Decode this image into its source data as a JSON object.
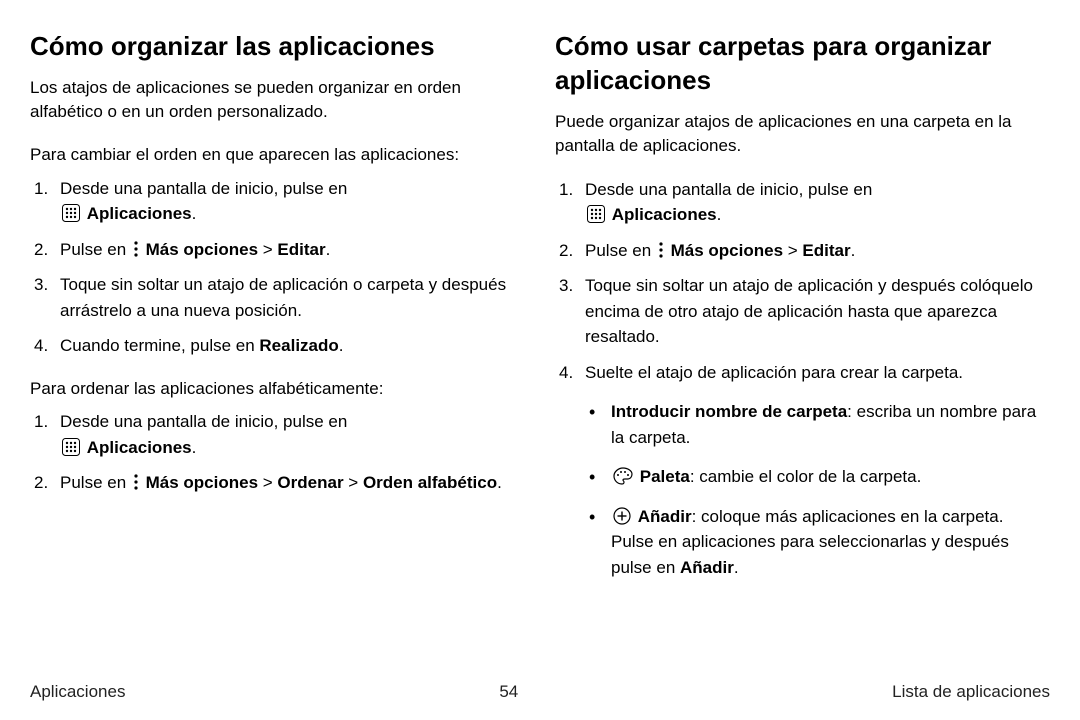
{
  "left": {
    "heading": "Cómo organizar las aplicaciones",
    "p1": "Los atajos de aplicaciones se pueden organizar en orden alfabético o en un orden personalizado.",
    "intro1": "Para cambiar el orden en que aparecen las aplicaciones:",
    "l1": {
      "s1a": "Desde una pantalla de inicio, pulse en ",
      "s1b": "Aplicaciones",
      "s1c": ".",
      "s2a": "Pulse en ",
      "s2b": "Más opciones",
      "s2c": " > ",
      "s2d": "Editar",
      "s2e": ".",
      "s3": "Toque sin soltar un atajo de aplicación o carpeta y después arrástrelo a una nueva posición.",
      "s4a": "Cuando termine, pulse en ",
      "s4b": "Realizado",
      "s4c": "."
    },
    "intro2": "Para ordenar las aplicaciones alfabéticamente:",
    "l2": {
      "s1a": "Desde una pantalla de inicio, pulse en ",
      "s1b": "Aplicaciones",
      "s1c": ".",
      "s2a": "Pulse en ",
      "s2b": "Más opciones",
      "s2c": " > ",
      "s2d": "Ordenar",
      "s2e": " > ",
      "s2f": "Orden alfabético",
      "s2g": "."
    }
  },
  "right": {
    "heading": "Cómo usar carpetas para organizar aplicaciones",
    "p1": "Puede organizar atajos de aplicaciones en una carpeta en la pantalla de aplicaciones.",
    "l1": {
      "s1a": "Desde una pantalla de inicio, pulse en ",
      "s1b": "Aplicaciones",
      "s1c": ".",
      "s2a": "Pulse en ",
      "s2b": "Más opciones",
      "s2c": " > ",
      "s2d": "Editar",
      "s2e": ".",
      "s3": "Toque sin soltar un atajo de aplicación y después colóquelo encima de otro atajo de aplicación hasta que aparezca resaltado.",
      "s4": "Suelte el atajo de aplicación para crear la carpeta.",
      "b1a": "Introducir nombre de carpeta",
      "b1b": ": escriba un nombre para la carpeta.",
      "b2a": "Paleta",
      "b2b": ": cambie el color de la carpeta.",
      "b3a": "Añadir",
      "b3b": ": coloque más aplicaciones en la carpeta. Pulse en aplicaciones para seleccionarlas y después pulse en ",
      "b3c": "Añadir",
      "b3d": "."
    }
  },
  "footer": {
    "left": "Aplicaciones",
    "center": "54",
    "right": "Lista de aplicaciones"
  }
}
